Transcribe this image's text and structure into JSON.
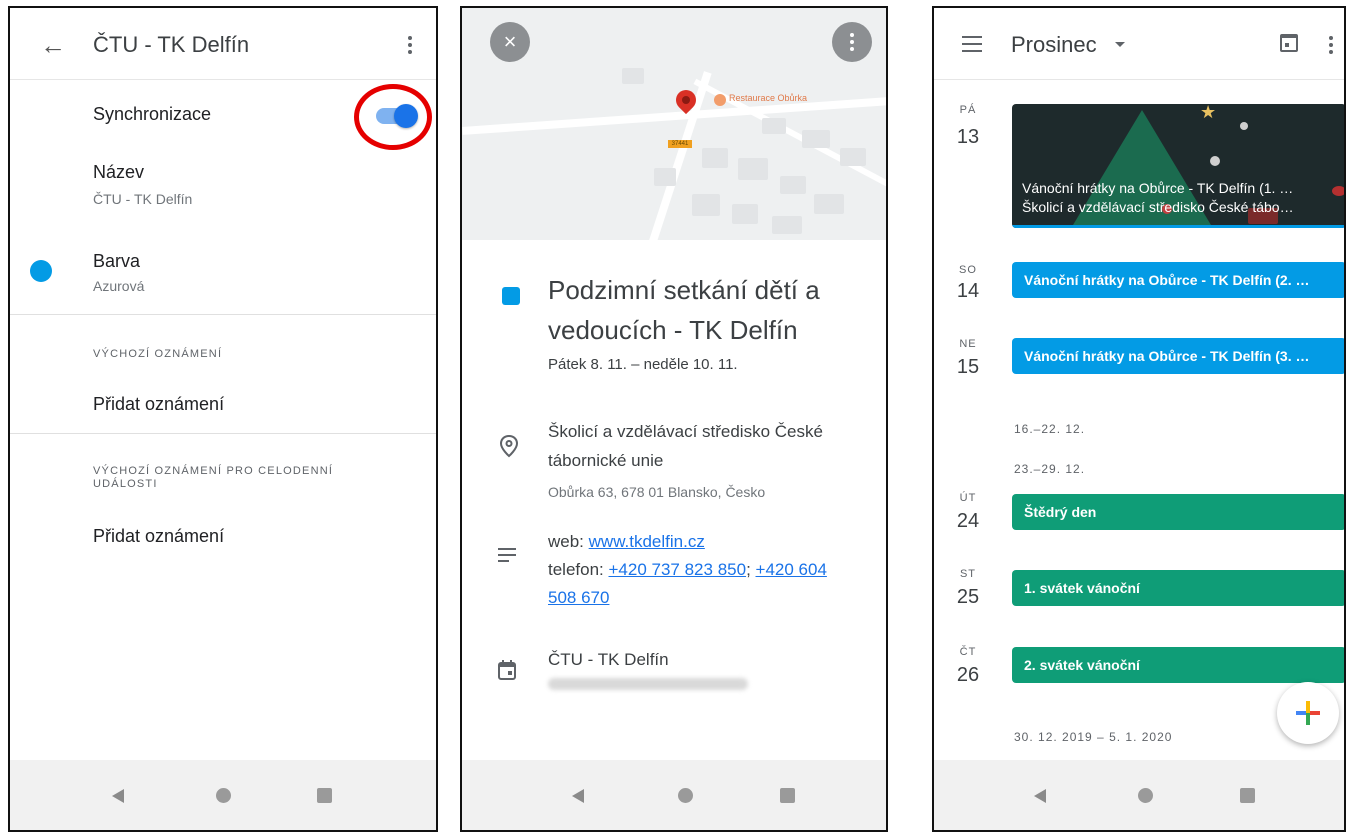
{
  "screen1": {
    "title": "ČTU - TK Delfín",
    "sync_label": "Synchronizace",
    "sync_enabled": true,
    "name_label": "Název",
    "name_value": "ČTU - TK Delfín",
    "color_label": "Barva",
    "color_value": "Azurová",
    "color_hex": "#039be5",
    "default_notif_header": "VÝCHOZÍ OZNÁMENÍ",
    "add_notif_1": "Přidat oznámení",
    "allday_notif_header_1": "VÝCHOZÍ OZNÁMENÍ PRO CELODENNÍ",
    "allday_notif_header_2": "UDÁLOSTI",
    "add_notif_2": "Přidat oznámení",
    "highlight_color": "#e50000"
  },
  "screen2": {
    "map_poi": "Restaurace Obůrka",
    "map_road": "37441",
    "event_title": "Podzimní setkání dětí a vedoucích - TK Delfín",
    "event_date": "Pátek 8. 11. – neděle 10. 11.",
    "location_line_1": "Školicí a vzdělávací středisko České",
    "location_line_2": "tábornické unie",
    "address": "Obůrka 63, 678 01 Blansko, Česko",
    "desc_web_prefix": "web: ",
    "desc_web_link": "www.tkdelfin.cz",
    "desc_phone_prefix": "telefon: ",
    "desc_phone_1": "+420 737 823 850",
    "desc_phone_sep": "; ",
    "desc_phone_2a": "+420 604",
    "desc_phone_2b": "508 670",
    "calendar_name": "ČTU - TK Delfín",
    "event_color": "#039be5"
  },
  "screen3": {
    "month": "Prosinec",
    "days": [
      {
        "abbr": "PÁ",
        "num": "13"
      },
      {
        "abbr": "SO",
        "num": "14"
      },
      {
        "abbr": "NE",
        "num": "15"
      },
      {
        "abbr": "ÚT",
        "num": "24"
      },
      {
        "abbr": "ST",
        "num": "25"
      },
      {
        "abbr": "ČT",
        "num": "26"
      }
    ],
    "card_line_1": "Vánoční hrátky na Obůrce - TK Delfín (1. …",
    "card_line_2": "Školicí a vzdělávací středisko České tábo…",
    "event_14": "Vánoční hrátky na Obůrce - TK Delfín (2. …",
    "event_15": "Vánoční hrátky na Obůrce - TK Delfín (3. …",
    "week_1": "16.–22. 12.",
    "week_2": "23.–29. 12.",
    "event_24": "Štědrý den",
    "event_25": "1. svátek vánoční",
    "event_26": "2. svátek vánoční",
    "week_3": "30. 12. 2019 – 5. 1. 2020",
    "blue_color": "#039be5",
    "green_color": "#0f9d77"
  },
  "icons": {
    "back": "arrow-left-icon",
    "menu": "more-vert-icon",
    "close": "close-icon",
    "location": "location-pin-icon",
    "notes": "notes-icon",
    "calendar": "calendar-icon",
    "hamburger": "menu-icon",
    "add": "add-icon"
  }
}
